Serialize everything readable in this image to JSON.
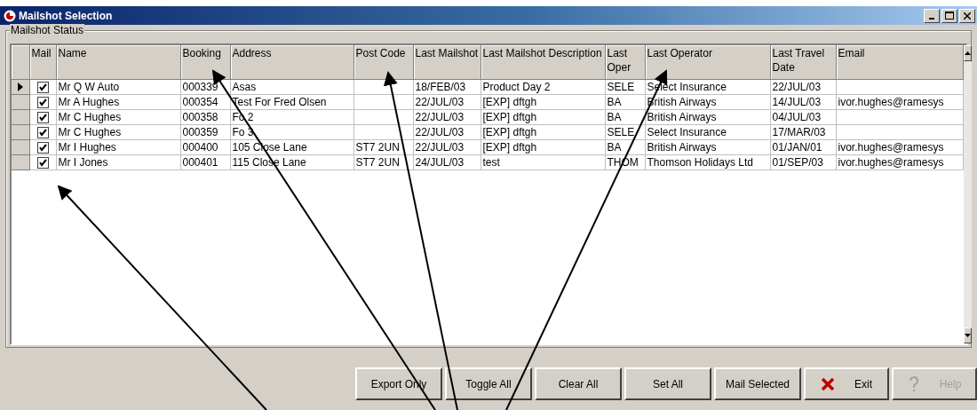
{
  "window": {
    "title": "Mailshot Selection"
  },
  "group": {
    "label": "Mailshot Status"
  },
  "table": {
    "columns": [
      "Mail",
      "Name",
      "Booking",
      "Address",
      "Post Code",
      "Last Mailshot",
      "Last Mailshot Description",
      "Last Oper",
      "Last Operator",
      "Last Travel Date",
      "Email"
    ],
    "rows": [
      {
        "current": true,
        "mail": true,
        "cells": [
          "",
          "Mr Q W Auto",
          "000339",
          "Asas",
          "",
          "18/FEB/03",
          "Product Day 2",
          "SELE",
          "Select Insurance",
          "22/JUL/03",
          ""
        ]
      },
      {
        "current": false,
        "mail": true,
        "cells": [
          "",
          "Mr A Hughes",
          "000354",
          "Test For Fred Olsen",
          "",
          "22/JUL/03",
          "[EXP] dftgh",
          "BA",
          "British Airways",
          "14/JUL/03",
          "ivor.hughes@ramesys"
        ]
      },
      {
        "current": false,
        "mail": true,
        "cells": [
          "",
          "Mr C Hughes",
          "000358",
          "Fo 2",
          "",
          "22/JUL/03",
          "[EXP] dftgh",
          "BA",
          "British Airways",
          "04/JUL/03",
          ""
        ]
      },
      {
        "current": false,
        "mail": true,
        "cells": [
          "",
          "Mr C Hughes",
          "000359",
          "Fo 3",
          "",
          "22/JUL/03",
          "[EXP] dftgh",
          "SELE",
          "Select Insurance",
          "17/MAR/03",
          ""
        ]
      },
      {
        "current": false,
        "mail": true,
        "cells": [
          "",
          "Mr I Hughes",
          "000400",
          "105 Close Lane",
          "ST7 2UN",
          "22/JUL/03",
          "[EXP] dftgh",
          "BA",
          "British Airways",
          "01/JAN/01",
          "ivor.hughes@ramesys"
        ]
      },
      {
        "current": false,
        "mail": true,
        "cells": [
          "",
          "Mr I Jones",
          "000401",
          "115 Close Lane",
          "ST7 2UN",
          "24/JUL/03",
          "test",
          "THOM",
          "Thomson Holidays Ltd",
          "01/SEP/03",
          "ivor.hughes@ramesys"
        ]
      }
    ]
  },
  "buttons": [
    {
      "label": "Export Only",
      "kind": "plain",
      "disabled": false
    },
    {
      "label": "Toggle All",
      "kind": "plain",
      "disabled": false
    },
    {
      "label": "Clear All",
      "kind": "plain",
      "disabled": false
    },
    {
      "label": "Set All",
      "kind": "plain",
      "disabled": false
    },
    {
      "label": "Mail Selected",
      "kind": "plain",
      "disabled": false
    },
    {
      "label": "Exit",
      "kind": "exit",
      "disabled": false
    },
    {
      "label": "Help",
      "kind": "help",
      "disabled": true
    }
  ]
}
